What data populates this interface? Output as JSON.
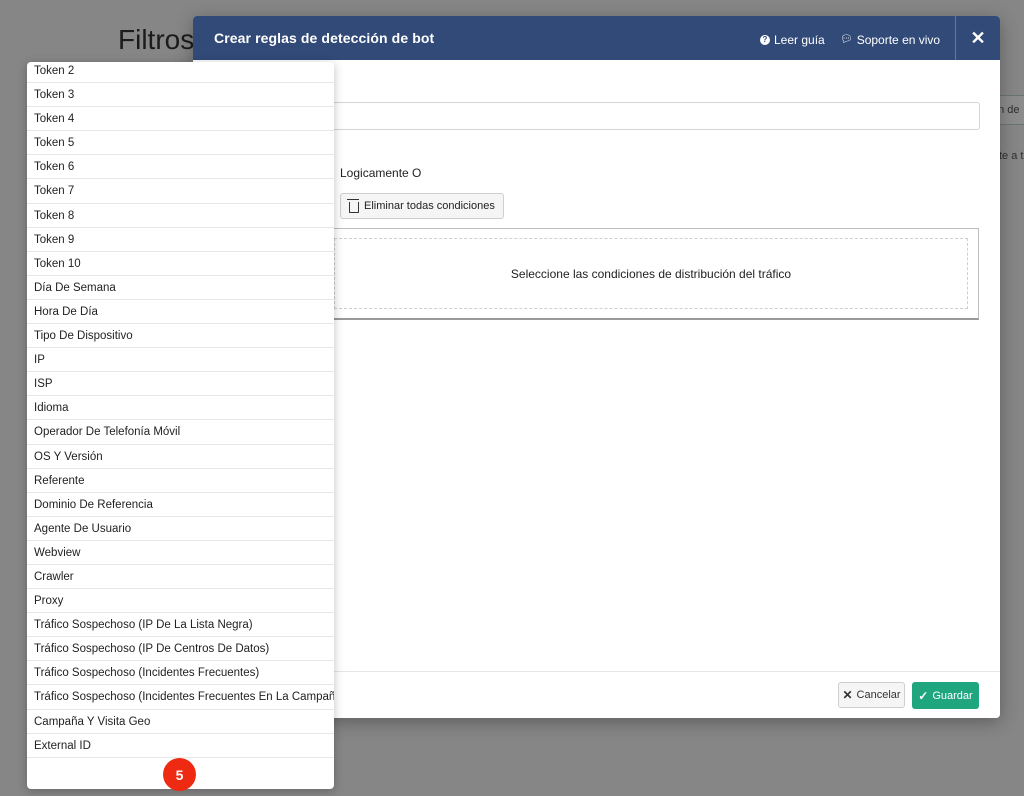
{
  "background": {
    "page_title": "Filtros",
    "right_box_text": "ón de",
    "right_text": "te a t"
  },
  "modal": {
    "title": "Crear reglas de detección de bot",
    "guide_link": "Leer guía",
    "support_link": "Soporte en vivo",
    "logic_label": "Logicamente O",
    "delete_all_label": "Eliminar todas condiciones",
    "conditions_placeholder": "Seleccione las condiciones de distribución del tráfico",
    "cancel_label": "Cancelar",
    "save_label": "Guardar"
  },
  "dropdown": {
    "items": [
      "Token 2",
      "Token 3",
      "Token 4",
      "Token 5",
      "Token 6",
      "Token 7",
      "Token 8",
      "Token 9",
      "Token 10",
      "Día De Semana",
      "Hora De Día",
      "Tipo De Dispositivo",
      "IP",
      "ISP",
      "Idioma",
      "Operador De Telefonía Móvil",
      "OS Y Versión",
      "Referente",
      "Dominio De Referencia",
      "Agente De Usuario",
      "Webview",
      "Crawler",
      "Proxy",
      "Tráfico Sospechoso (IP De La Lista Negra)",
      "Tráfico Sospechoso (IP De Centros De Datos)",
      "Tráfico Sospechoso (Incidentes Frecuentes)",
      "Tráfico Sospechoso (Incidentes Frecuentes En La Campaña)",
      "Campaña Y Visita Geo",
      "External ID"
    ]
  },
  "badge": {
    "number": "5"
  },
  "colors": {
    "header_bg": "#324a78",
    "save_bg": "#1fa67f",
    "badge_bg": "#ee2a12"
  }
}
